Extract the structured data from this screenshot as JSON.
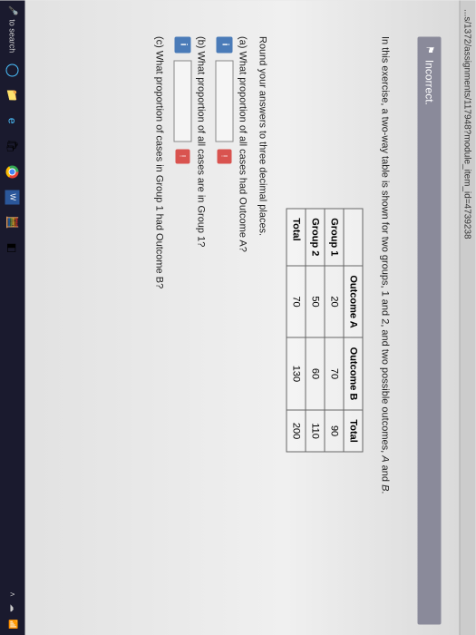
{
  "url_fragment": "...s/1372/assignments/117948?module_item_id=4739238",
  "banner": {
    "label": "Incorrect."
  },
  "intro": {
    "prefix": "In this exercise, a two-way table is shown for two groups, 1 and 2, and two possible outcomes, ",
    "italicA": "A",
    "mid": " and ",
    "italicB": "B",
    "suffix": "."
  },
  "table": {
    "col1": "Outcome A",
    "col2": "Outcome B",
    "col3": "Total",
    "rows": [
      {
        "label": "Group 1",
        "a": "20",
        "b": "70",
        "t": "90"
      },
      {
        "label": "Group 2",
        "a": "50",
        "b": "60",
        "t": "110"
      },
      {
        "label": "Total",
        "a": "70",
        "b": "130",
        "t": "200"
      }
    ]
  },
  "instruction": "Round your answers to three decimal places.",
  "questions": {
    "a": "(a) What proportion of all cases had Outcome A?",
    "b": "(b) What proportion of all cases are in Group 1?",
    "c": "(c) What proportion of cases in Group 1 had Outcome B?"
  },
  "info_symbol": "i",
  "error_symbol": "!",
  "taskbar": {
    "search_hint": "to search",
    "cortana": "◯"
  }
}
